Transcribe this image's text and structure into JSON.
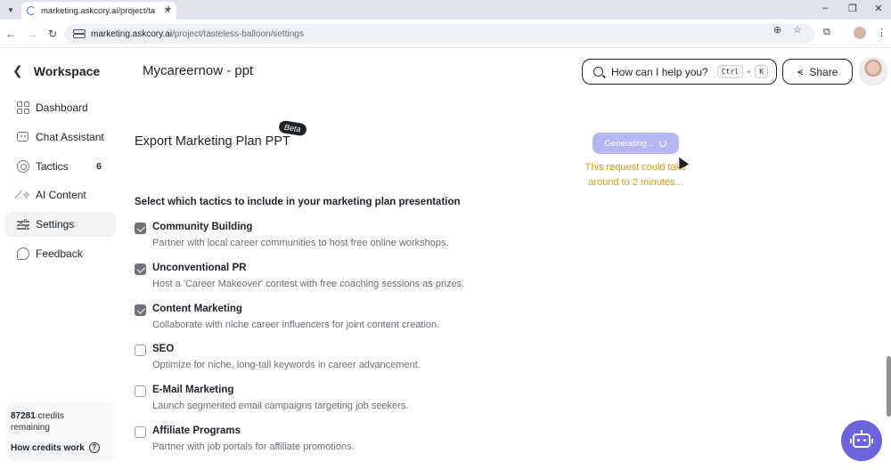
{
  "browser": {
    "tab_title": "marketing.askcory.ai/project/ta",
    "url_domain": "marketing.askcory.ai",
    "url_path": "/project/tasteless-balloon/settings"
  },
  "sidebar": {
    "workspace_label": "Workspace",
    "items": [
      {
        "label": "Dashboard",
        "icon": "dashboard-icon"
      },
      {
        "label": "Chat Assistant",
        "icon": "bot-icon"
      },
      {
        "label": "Tactics",
        "icon": "target-icon",
        "badge": "6"
      },
      {
        "label": "AI Content",
        "icon": "magic-wand-icon"
      },
      {
        "label": "Settings",
        "icon": "sliders-icon",
        "active": true
      },
      {
        "label": "Feedback",
        "icon": "chat-bubble-icon"
      }
    ],
    "credits_count": "87281",
    "credits_suffix": "credits",
    "credits_remaining": "remaining",
    "how_credits": "How credits work"
  },
  "header": {
    "project_title": "Mycareernow - ppt",
    "help_placeholder": "How can I help you?",
    "kbd_ctrl": "Ctrl",
    "kbd_plus": "+",
    "kbd_k": "K",
    "share_label": "Share"
  },
  "export": {
    "title": "Export Marketing Plan PPT",
    "beta": "Beta",
    "generating": "Generating...",
    "note": "This request could take around to 2 minutes...",
    "select_label": "Select which tactics to include in your marketing plan presentation"
  },
  "tactics": [
    {
      "name": "Community Building",
      "desc": "Partner with local career communities to host free online workshops.",
      "checked": true
    },
    {
      "name": "Unconventional PR",
      "desc": "Host a 'Career Makeover' contest with free coaching sessions as prizes.",
      "checked": true
    },
    {
      "name": "Content Marketing",
      "desc": "Collaborate with niche career influencers for joint content creation.",
      "checked": true
    },
    {
      "name": "SEO",
      "desc": "Optimize for niche, long-tail keywords in career advancement.",
      "checked": false
    },
    {
      "name": "E-Mail Marketing",
      "desc": "Launch segmented email campaigns targeting job seekers.",
      "checked": false
    },
    {
      "name": "Affiliate Programs",
      "desc": "Partner with job portals for affiliate promotions.",
      "checked": false
    }
  ],
  "colors": {
    "accent": "#6d63dd",
    "generating_button": "#b7b5f2",
    "note_text": "#d89a16"
  }
}
